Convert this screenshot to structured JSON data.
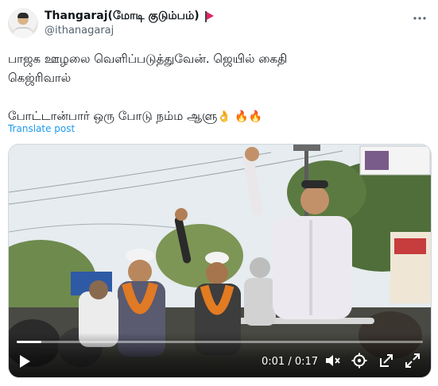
{
  "tweet": {
    "display_name": "Thangaraj(மோடி குடும்பம்)",
    "handle": "@ithanagaraj",
    "line1": "பாஜக ஊழலை வெளிப்படுத்துவேன். ஜெயில் கைதி",
    "line2": "கெஜ்ரிவால்",
    "line3": "போட்டான்பார் ஒரு போடு நம்ம ஆளு",
    "emojis": "👌 🔥🔥",
    "translate_label": "Translate post"
  },
  "video": {
    "current_time": "0:01",
    "separator": "/",
    "duration": "0:17",
    "progress": 0.06
  },
  "icons": {
    "more": "more-options-icon",
    "play": "play-icon",
    "mute": "mute-icon",
    "settings": "settings-icon",
    "popout": "popout-icon",
    "fullscreen": "fullscreen-icon"
  }
}
